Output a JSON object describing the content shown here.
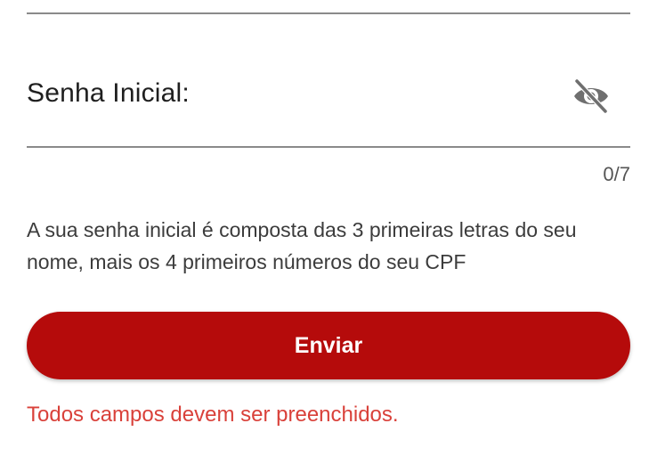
{
  "form": {
    "password_label": "Senha Inicial:",
    "password_visibility_icon": "eye-off-icon",
    "char_counter": "0/7",
    "helper_text": "A sua senha inicial é composta das 3 primeiras letras do seu nome, mais os 4 primeiros números do seu CPF",
    "submit_label": "Enviar",
    "error_message": "Todos campos devem ser preenchidos."
  },
  "colors": {
    "primary_button": "#b50b0b",
    "error_text": "#d9413a",
    "divider": "#8a8a8a",
    "icon": "#6f6f6f"
  }
}
